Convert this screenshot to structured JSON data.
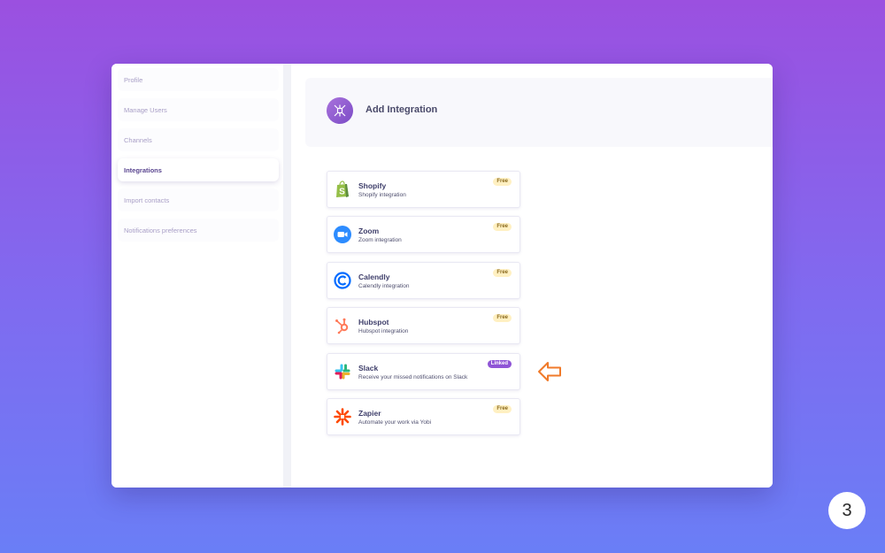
{
  "sidebar": {
    "items": [
      {
        "label": "Profile"
      },
      {
        "label": "Manage Users"
      },
      {
        "label": "Channels"
      },
      {
        "label": "Integrations"
      },
      {
        "label": "Import contacts"
      },
      {
        "label": "Notifications preferences"
      }
    ],
    "active_index": 3
  },
  "header": {
    "title": "Add Integration",
    "icon": "integration-hub-icon"
  },
  "integrations": [
    {
      "name": "Shopify",
      "description": "Shopify integration",
      "badge": "Free",
      "icon": "shopify-icon",
      "color": "#95bf47"
    },
    {
      "name": "Zoom",
      "description": "Zoom integration",
      "badge": "Free",
      "icon": "zoom-icon",
      "color": "#2d8cff"
    },
    {
      "name": "Calendly",
      "description": "Calendly integration",
      "badge": "Free",
      "icon": "calendly-icon",
      "color": "#006bff"
    },
    {
      "name": "Hubspot",
      "description": "Hubspot integration",
      "badge": "Free",
      "icon": "hubspot-icon",
      "color": "#ff7a59"
    },
    {
      "name": "Slack",
      "description": "Receive your missed notifications on Slack",
      "badge": "Linked",
      "icon": "slack-icon",
      "color": "#8f55d6"
    },
    {
      "name": "Zapier",
      "description": "Automate your work via Yobi",
      "badge": "Free",
      "icon": "zapier-icon",
      "color": "#ff4a00"
    }
  ],
  "annotation": {
    "icon": "arrow-left-icon",
    "color": "#f07a2a"
  },
  "step_badge": {
    "number": "3"
  },
  "colors": {
    "accent": "#8f55d6",
    "free_badge_bg": "#fff0c2"
  }
}
